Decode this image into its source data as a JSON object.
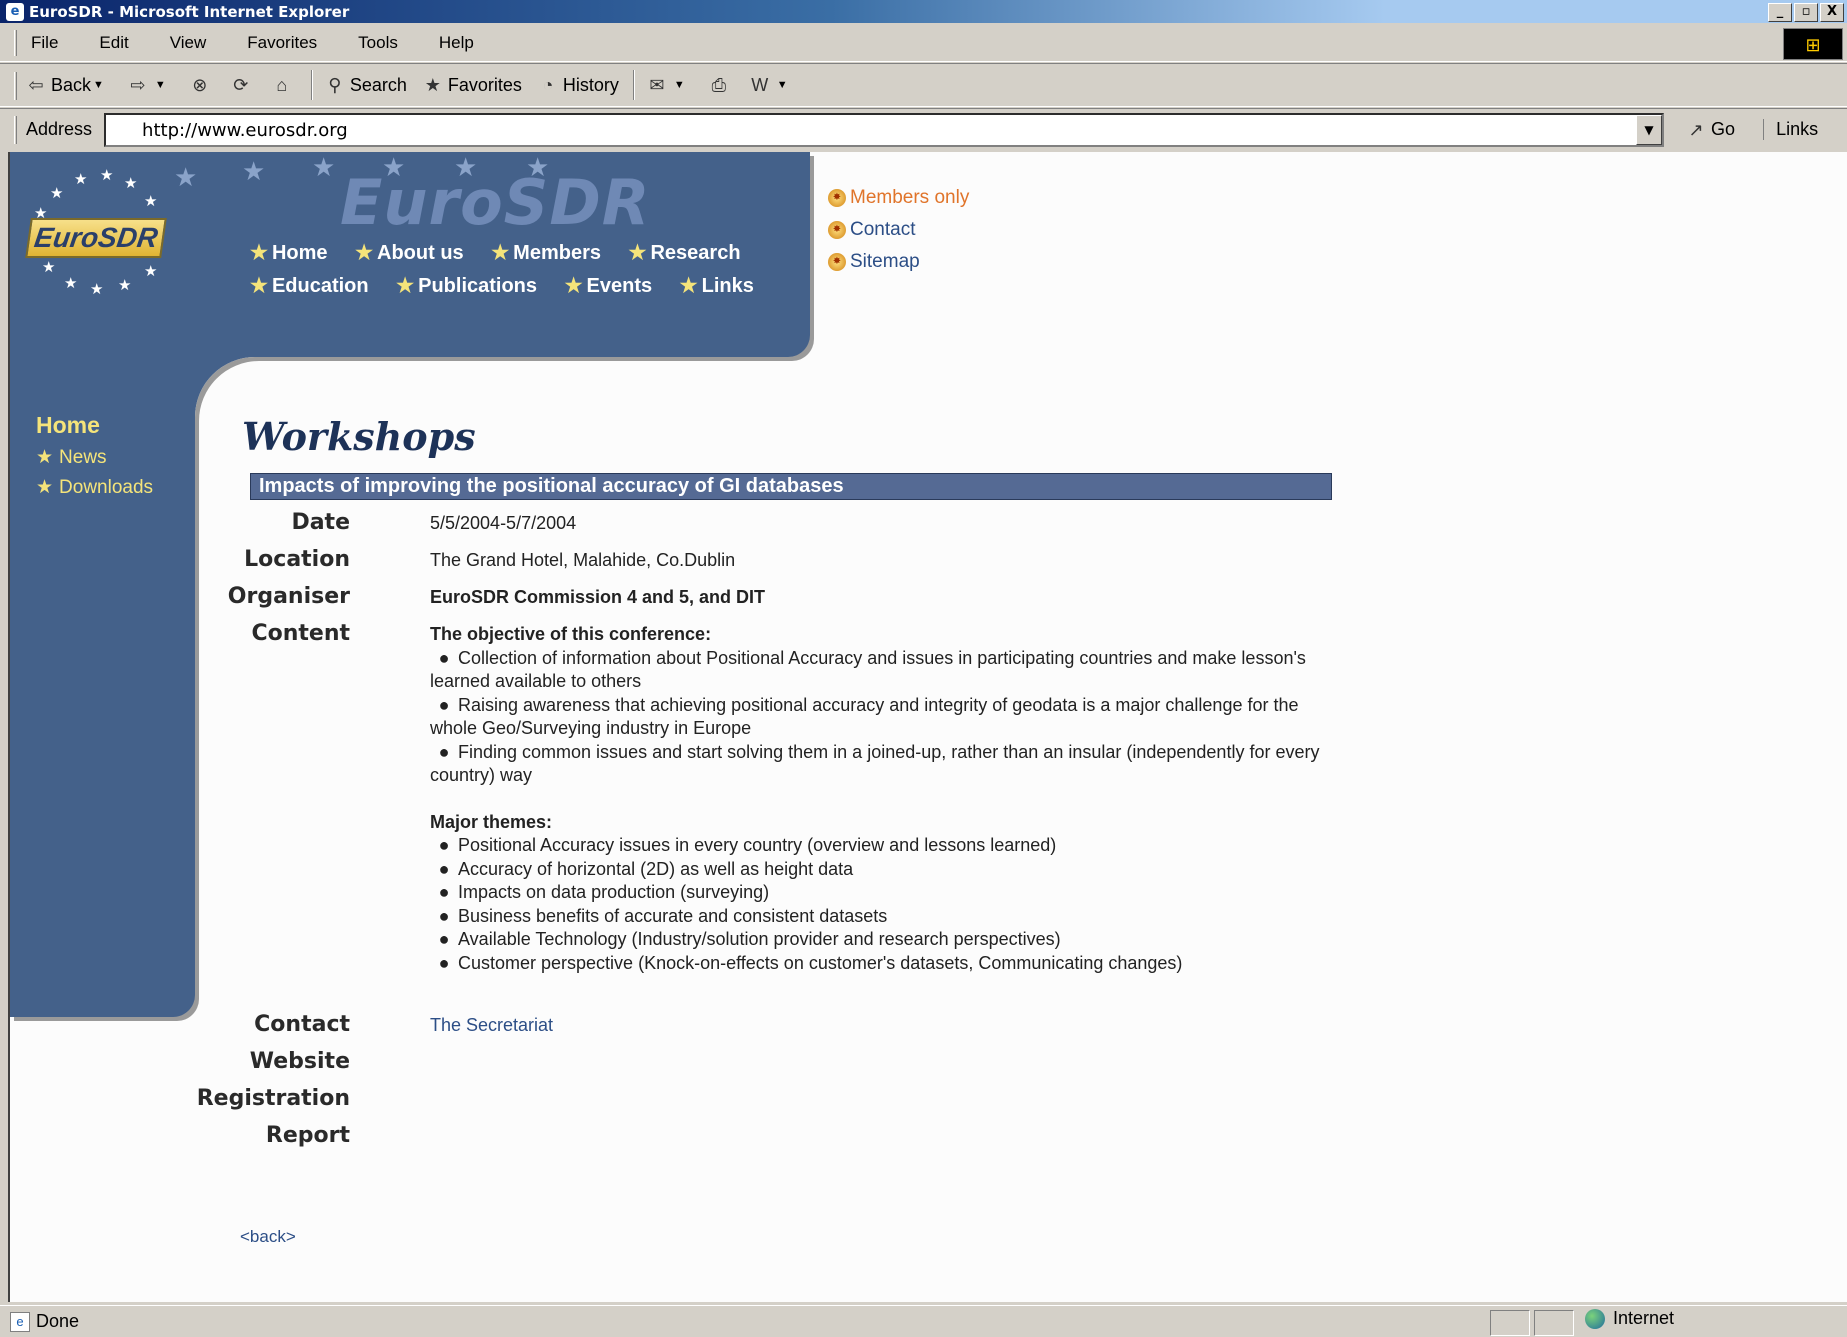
{
  "window": {
    "title": "EuroSDR - Microsoft Internet Explorer",
    "buttons": {
      "minimize": "_",
      "maximize": "▫",
      "close": "X"
    }
  },
  "menu": [
    "File",
    "Edit",
    "View",
    "Favorites",
    "Tools",
    "Help"
  ],
  "toolbar": {
    "back": "Back",
    "search": "Search",
    "favorites": "Favorites",
    "history": "History"
  },
  "address": {
    "label": "Address",
    "url": "http://www.eurosdr.org",
    "go": "Go",
    "links": "Links"
  },
  "site": {
    "logo_text": "EuroSDR",
    "big_title": "EuroSDR",
    "nav_row1": [
      "Home",
      "About us",
      "Members",
      "Research"
    ],
    "nav_row2": [
      "Education",
      "Publications",
      "Events",
      "Links"
    ],
    "top_links": {
      "members_only": "Members only",
      "contact": "Contact",
      "sitemap": "Sitemap"
    },
    "side_nav": {
      "title": "Home",
      "items": [
        "News",
        "Downloads"
      ]
    }
  },
  "content": {
    "page_title": "Workshops",
    "event_title": "Impacts of improving the positional accuracy of GI databases",
    "labels": {
      "date": "Date",
      "location": "Location",
      "organiser": "Organiser",
      "content": "Content",
      "contact": "Contact",
      "website": "Website",
      "registration": "Registration",
      "report": "Report"
    },
    "date": "5/5/2004-5/7/2004",
    "location": "The Grand Hotel, Malahide, Co.Dublin",
    "organiser": "EuroSDR Commission 4 and 5, and DIT",
    "objective_heading": "The objective of this conference:",
    "objectives": [
      "Collection of information about Positional Accuracy and issues in participating countries and make lesson's learned available to others",
      "Raising awareness that achieving positional accuracy and integrity of geodata is a major challenge for the whole Geo/Surveying industry in Europe",
      "Finding common issues and start solving them in a joined-up, rather than an insular (independently for every country) way"
    ],
    "themes_heading": "Major themes:",
    "themes": [
      "Positional Accuracy issues in every country (overview and lessons learned)",
      "Accuracy of horizontal (2D) as well as height data",
      "Impacts on data production (surveying)",
      "Business benefits of accurate and consistent datasets",
      "Available Technology (Industry/solution provider and research perspectives)",
      "Customer perspective (Knock-on-effects on customer's datasets, Communicating changes)"
    ],
    "contact_link": "The Secretariat",
    "back_link": "<back>"
  },
  "status": {
    "text": "Done",
    "zone": "Internet"
  },
  "icons": {
    "back": "back-arrow-icon",
    "forward": "forward-arrow-icon",
    "stop": "stop-icon",
    "refresh": "refresh-icon",
    "home": "home-icon",
    "search": "search-icon",
    "favorites": "favorites-icon",
    "history": "history-icon",
    "mail": "mail-icon",
    "print": "print-icon",
    "edit": "edit-icon"
  }
}
